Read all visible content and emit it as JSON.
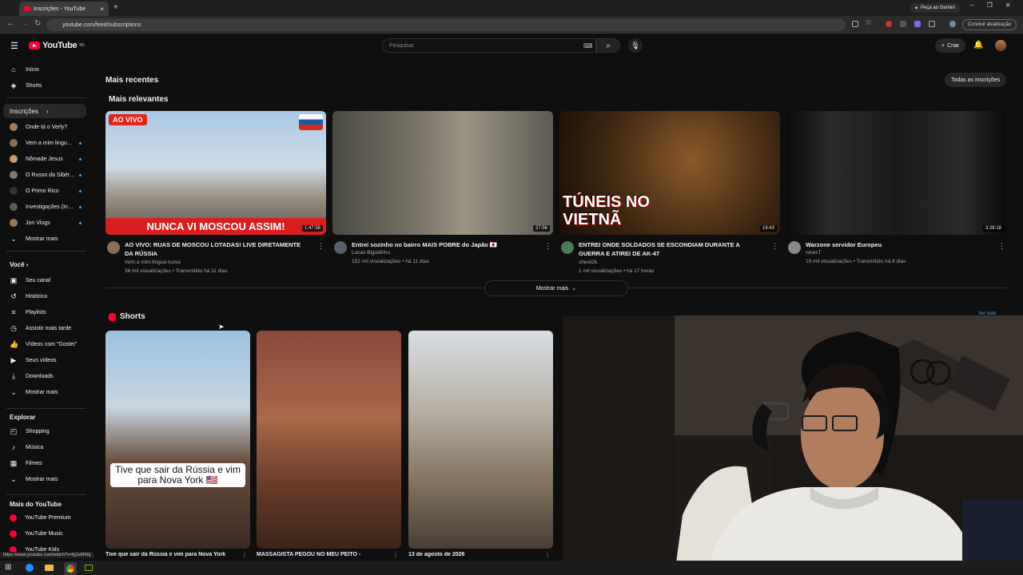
{
  "browser": {
    "tab_title": "Inscrições - YouTube",
    "tab_close": "×",
    "new_tab": "+",
    "url": "youtube.com/feed/subscriptions",
    "gemini_label": "Peça ao Gemini",
    "update_label": "Concluir atualização",
    "win_min": "−",
    "win_max": "❐",
    "win_close": "✕"
  },
  "header": {
    "logo_text": "YouTube",
    "logo_region": "BR",
    "search_placeholder": "Pesquisar",
    "create_label": "Criar"
  },
  "sidebar": {
    "top": [
      {
        "label": "Início",
        "icon": "home-icon",
        "glyph": "⌂"
      },
      {
        "label": "Shorts",
        "icon": "shorts-icon",
        "glyph": "◈"
      }
    ],
    "subs_heading": "Inscrições",
    "subs": [
      {
        "label": "Onde tá o Verly?",
        "color": "#a67c52",
        "dot": false
      },
      {
        "label": "Vem a mim lingu…",
        "color": "#8a6d55",
        "dot": true
      },
      {
        "label": "Nômade Jesus",
        "color": "#c49a6c",
        "dot": true
      },
      {
        "label": "O Russo da Sibér…",
        "color": "#7a7a7a",
        "dot": true
      },
      {
        "label": "O Primo Rico",
        "color": "#333333",
        "dot": true
      },
      {
        "label": "Investigações (In…",
        "color": "#5a5a5a",
        "dot": true
      },
      {
        "label": "Jon Vlogs",
        "color": "#9a7b5a",
        "dot": true
      }
    ],
    "subs_more": "Mostrar mais",
    "voce_heading": "Você",
    "voce": [
      {
        "label": "Seu canal",
        "glyph": "▣",
        "icon": "channel-icon"
      },
      {
        "label": "Histórico",
        "glyph": "↺",
        "icon": "history-icon"
      },
      {
        "label": "Playlists",
        "glyph": "≡",
        "icon": "playlists-icon"
      },
      {
        "label": "Assistir mais tarde",
        "glyph": "◷",
        "icon": "watch-later-icon"
      },
      {
        "label": "Vídeos com \"Gostei\"",
        "glyph": "👍",
        "icon": "like-icon"
      },
      {
        "label": "Seus vídeos",
        "glyph": "▶",
        "icon": "your-videos-icon"
      },
      {
        "label": "Downloads",
        "glyph": "⤓",
        "icon": "download-icon"
      },
      {
        "label": "Mostrar mais",
        "glyph": "⌄",
        "icon": "chevron-down-icon"
      }
    ],
    "explore_heading": "Explorar",
    "explore": [
      {
        "label": "Shopping",
        "glyph": "◰",
        "icon": "shopping-icon"
      },
      {
        "label": "Música",
        "glyph": "♪",
        "icon": "music-icon"
      },
      {
        "label": "Filmes",
        "glyph": "▦",
        "icon": "movies-icon"
      },
      {
        "label": "Mostrar mais",
        "glyph": "⌄",
        "icon": "chevron-down-icon"
      }
    ],
    "more_heading": "Mais do YouTube",
    "more": [
      {
        "label": "YouTube Premium"
      },
      {
        "label": "YouTube Music"
      },
      {
        "label": "YouTube Kids"
      }
    ]
  },
  "main": {
    "recent_heading": "Mais recentes",
    "all_subs_button": "Todas as inscrições",
    "relevant_heading": "Mais relevantes",
    "videos": [
      {
        "title": "AO VIVO: RUAS DE MOSCOU LOTADAS! LIVE DIRETAMENTE DA RÚSSIA",
        "channel": "Vem a mim língua russa",
        "meta": "36 mil visualizações • Transmitido há 11 dias",
        "duration": "1:47:58",
        "overlay": "NUNCA VI MOSCOU ASSIM!",
        "badge": "AO VIVO",
        "bg": "linear-gradient(180deg,#a9c8e6 0%,#cfdbe6 45%,#9a8f82 70%,#5b5550 100%)",
        "avatar": "#8a6d55"
      },
      {
        "title": "Entrei sozinho no bairro MAIS POBRE do Japão 🇯🇵",
        "channel": "Lucas Bigodinho",
        "meta": "152 mil visualizações • há 11 dias",
        "duration": "27:56",
        "overlay": "",
        "badge": "",
        "bg": "linear-gradient(90deg,#4a4a44 0%,#7a7568 40%,#9c9586 60%,#5c5a52 100%)",
        "avatar": "#55606a"
      },
      {
        "title": "ENTREI ONDE SOLDADOS SE ESCONDIAM DURANTE A GUERRA E ATIREI DE AK-47",
        "channel": "shevii2k",
        "meta": "1 mil visualizações • há 17 horas",
        "duration": "19:43",
        "overlay": "TÚNEIS NO VIETNÃ",
        "badge": "",
        "bg": "radial-gradient(circle at 60% 40%,#8a5a2a 0%,#3a2410 60%,#1a0f06 100%)",
        "avatar": "#4a7a5a"
      },
      {
        "title": "Warzone servidor Europeu",
        "channel": "ninexT",
        "meta": "19 mil visualizações • Transmitido há 8 dias",
        "duration": "3:28:18",
        "overlay": "",
        "badge": "",
        "bg": "linear-gradient(90deg,#0a0a0a 0%,#2a2a2a 20%,#1a1a1a 50%,#2a2a2a 80%,#0a0a0a 100%)",
        "avatar": "#888888"
      }
    ],
    "show_more": "Mostrar mais",
    "shorts_heading": "Shorts",
    "shorts_see_all": "Ver tudo",
    "shorts": [
      {
        "title": "Tive que sair da Rússia e vim para Nova York",
        "caption": "Tive que sair da Rússia e vim para Nova York 🇺🇸",
        "bg": "linear-gradient(180deg,#9cc0e0 0%,#c8d6e0 35%,#6b5040 60%,#3a2a22 100%)"
      },
      {
        "title": "MASSAGISTA PEGOU NO MEU PEITO -",
        "caption": "",
        "bg": "linear-gradient(180deg,#8a4a3a 0%,#a9684a 40%,#6b3e2a 70%,#3a2418 100%)"
      },
      {
        "title": "13 de agosto de 2026",
        "caption": "",
        "bg": "linear-gradient(180deg,#d8dee4 0%,#b8b2a8 35%,#8a7a68 65%,#4a3e34 100%)"
      }
    ]
  },
  "status_url": "https://www.youtube.com/watch?v=fg1eMWg"
}
